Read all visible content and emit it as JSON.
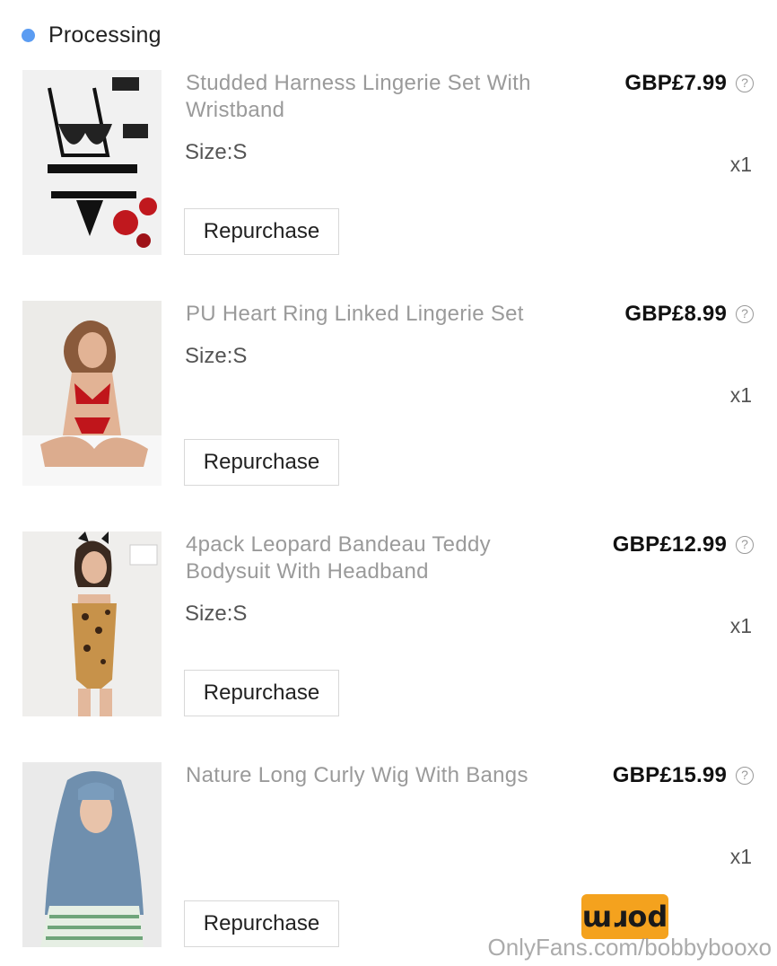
{
  "status": {
    "label": "Processing",
    "dot_color": "#5b9cf2"
  },
  "items": [
    {
      "title": "Studded Harness Lingerie Set With Wristband",
      "size": "Size:S",
      "price": "GBP£7.99",
      "qty": "x1",
      "button": "Repurchase"
    },
    {
      "title": "PU Heart Ring Linked Lingerie Set",
      "size": "Size:S",
      "price": "GBP£8.99",
      "qty": "x1",
      "button": "Repurchase"
    },
    {
      "title": "4pack Leopard Bandeau Teddy Bodysuit With Headband",
      "size": "Size:S",
      "price": "GBP£12.99",
      "qty": "x1",
      "button": "Repurchase"
    },
    {
      "title": "Nature Long Curly Wig With Bangs",
      "size": "",
      "price": "GBP£15.99",
      "qty": "x1",
      "button": "Repurchase"
    }
  ],
  "help_icon_glyph": "?",
  "watermark": {
    "badge": "ɯɹod",
    "text": "OnlyFans.com/bobbybooxo",
    "badge_color": "#f4a21e"
  }
}
